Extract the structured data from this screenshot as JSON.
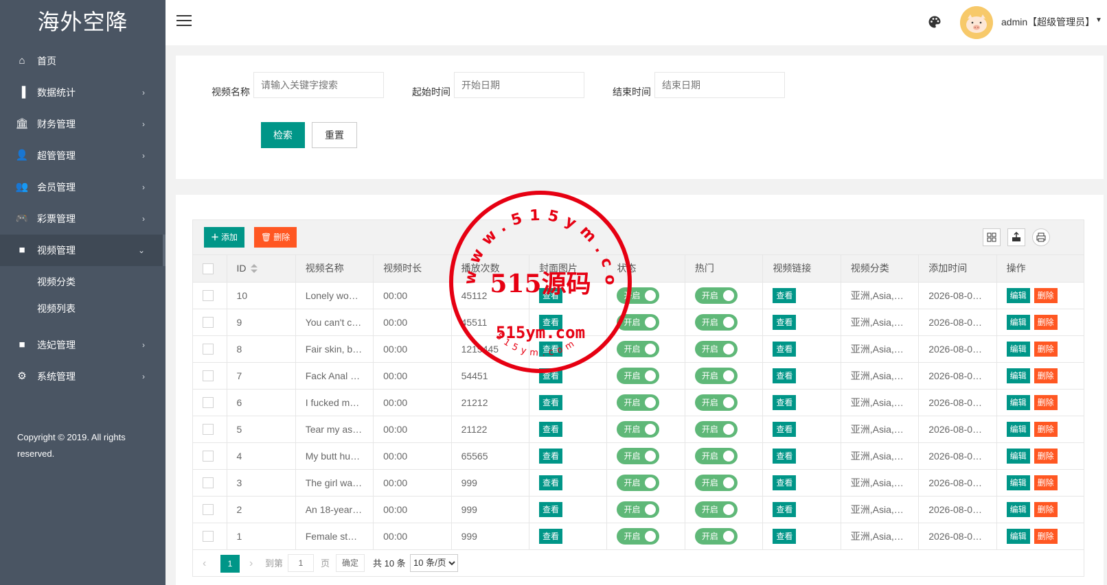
{
  "app": {
    "logo_text": "海外空降"
  },
  "sidebar": {
    "items": [
      {
        "label": "首页",
        "icon": "home-icon",
        "glyph": "⌂"
      },
      {
        "label": "数据统计",
        "icon": "bar-chart-icon",
        "glyph": "▐"
      },
      {
        "label": "财务管理",
        "icon": "bank-icon",
        "glyph": "🏛"
      },
      {
        "label": "超管管理",
        "icon": "user-icon",
        "glyph": "👤"
      },
      {
        "label": "会员管理",
        "icon": "users-icon",
        "glyph": "👥"
      },
      {
        "label": "彩票管理",
        "icon": "gamepad-icon",
        "glyph": "🎮"
      },
      {
        "label": "视频管理",
        "icon": "video-icon",
        "glyph": "■"
      },
      {
        "label": "选妃管理",
        "icon": "video-icon",
        "glyph": "■"
      },
      {
        "label": "系统管理",
        "icon": "gear-icon",
        "glyph": "⚙"
      }
    ],
    "submenu": [
      "视频分类",
      "视频列表"
    ],
    "copyright": "Copyright © 2019. All rights reserved."
  },
  "header": {
    "user": "admin【超级管理员】"
  },
  "search": {
    "name_label": "视频名称",
    "name_placeholder": "请输入关键字搜索",
    "start_label": "起始时间",
    "start_placeholder": "开始日期",
    "end_label": "结束时间",
    "end_placeholder": "结束日期",
    "search_button": "检索",
    "reset_button": "重置"
  },
  "toolbar": {
    "add_label": "添加",
    "delete_label": "删除"
  },
  "table": {
    "headers": [
      "ID",
      "视频名称",
      "视频时长",
      "播放次数",
      "封面图片",
      "状态",
      "热门",
      "视频链接",
      "视频分类",
      "添加时间",
      "操作"
    ],
    "view_label": "查看",
    "switch_label": "开启",
    "edit_label": "编辑",
    "del_label": "删除",
    "rows": [
      {
        "id": "10",
        "name": "Lonely wo…",
        "duration": "00:00",
        "plays": "45112",
        "category": "亚洲,Asia,…",
        "added": "2026-08-0…"
      },
      {
        "id": "9",
        "name": "You can't c…",
        "duration": "00:00",
        "plays": "45511",
        "category": "亚洲,Asia,…",
        "added": "2026-08-0…"
      },
      {
        "id": "8",
        "name": "Fair skin, b…",
        "duration": "00:00",
        "plays": "1215445",
        "category": "亚洲,Asia,…",
        "added": "2026-08-0…"
      },
      {
        "id": "7",
        "name": "Fack Anal …",
        "duration": "00:00",
        "plays": "54451",
        "category": "亚洲,Asia,…",
        "added": "2026-08-0…"
      },
      {
        "id": "6",
        "name": "I fucked m…",
        "duration": "00:00",
        "plays": "21212",
        "category": "亚洲,Asia,…",
        "added": "2026-08-0…"
      },
      {
        "id": "5",
        "name": "Tear my as…",
        "duration": "00:00",
        "plays": "21122",
        "category": "亚洲,Asia,…",
        "added": "2026-08-0…"
      },
      {
        "id": "4",
        "name": "My butt hu…",
        "duration": "00:00",
        "plays": "65565",
        "category": "亚洲,Asia,…",
        "added": "2026-08-0…"
      },
      {
        "id": "3",
        "name": "The girl wa…",
        "duration": "00:00",
        "plays": "999",
        "category": "亚洲,Asia,…",
        "added": "2026-08-0…"
      },
      {
        "id": "2",
        "name": "An 18-year…",
        "duration": "00:00",
        "plays": "999",
        "category": "亚洲,Asia,…",
        "added": "2026-08-0…"
      },
      {
        "id": "1",
        "name": "Female st…",
        "duration": "00:00",
        "plays": "999",
        "category": "亚洲,Asia,…",
        "added": "2026-08-0…"
      }
    ]
  },
  "pager": {
    "current": "1",
    "goto_label": "到第",
    "goto_value": "1",
    "page_label": "页",
    "ok_label": "确定",
    "total": "共 10 条",
    "per_page": "10 条/页"
  },
  "watermark": {
    "center": "515源码",
    "domain": "515ym.com",
    "top_ring": "www.515ym.com",
    "bottom_ring": "515ym.com"
  }
}
